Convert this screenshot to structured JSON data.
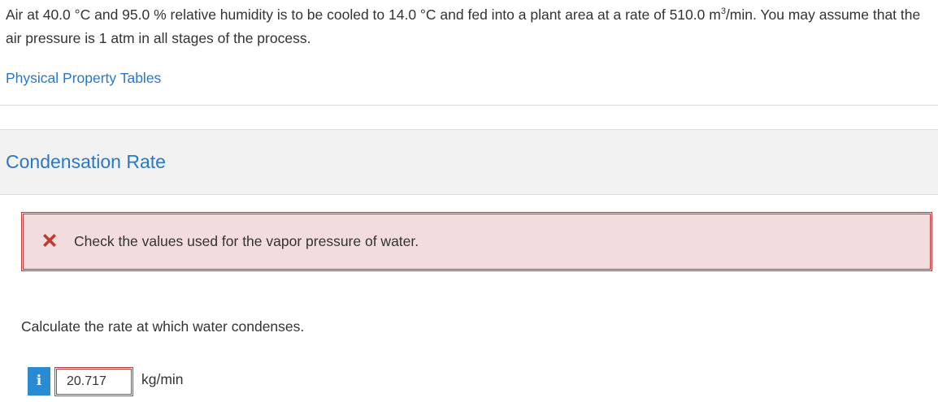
{
  "problem": {
    "text_before_exponent": "Air at 40.0 °C and 95.0 % relative humidity is to be cooled to 14.0 °C and fed into a plant area at a rate of 510.0 m",
    "exponent": "3",
    "text_after_exponent": "/min. You may assume that the air pressure is 1 atm in all stages of the process."
  },
  "links": {
    "physical_property_tables": "Physical Property Tables"
  },
  "section": {
    "title": "Condensation Rate"
  },
  "feedback": {
    "message": "Check the values used for the vapor pressure of water.",
    "icon": "x-mark-icon",
    "color": "#c0392b",
    "background": "#f3dcde"
  },
  "question": {
    "prompt": "Calculate the rate at which water condenses.",
    "info_label": "i",
    "answer_value": "20.717",
    "unit": "kg/min"
  },
  "colors": {
    "link": "#2a77c9",
    "info_button": "#2a8ad4",
    "error_border": "#b83a3a"
  }
}
